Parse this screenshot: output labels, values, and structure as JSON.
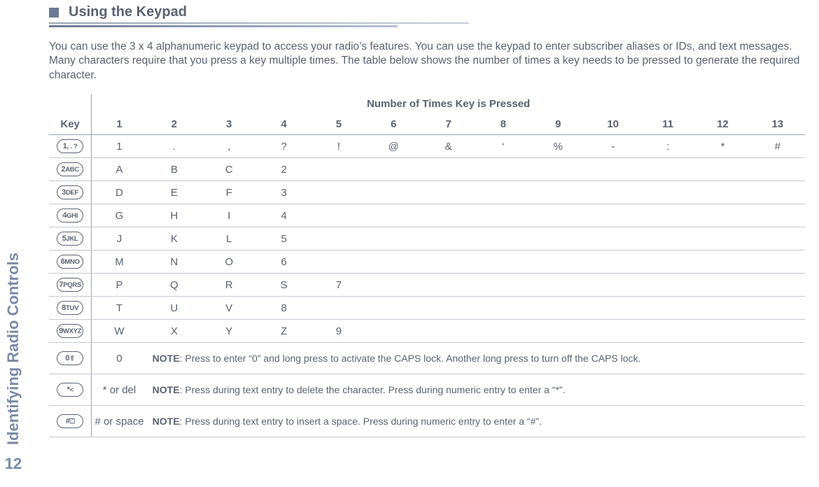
{
  "sidebar": {
    "label": "Identifying Radio Controls",
    "page": "12"
  },
  "section": {
    "title": "Using the Keypad",
    "intro": "You can use the 3 x 4 alphanumeric keypad to access your radio’s features. You can use the keypad to enter subscriber aliases or IDs, and text messages. Many characters require that you press a key multiple times. The table below shows the number of times a key needs to be pressed to generate the required character."
  },
  "table": {
    "span_label": "Number of Times Key is Pressed",
    "key_label": "Key",
    "cols": [
      "1",
      "2",
      "3",
      "4",
      "5",
      "6",
      "7",
      "8",
      "9",
      "10",
      "11",
      "12",
      "13"
    ],
    "rows": [
      {
        "key_main": "1",
        "key_sub": " , . ?",
        "vals": [
          "1",
          ".",
          ",",
          "?",
          "!",
          "@",
          "&",
          "‘",
          "%",
          "-",
          ":",
          "*",
          "#"
        ]
      },
      {
        "key_main": "2",
        "key_sub": " ABC",
        "vals": [
          "A",
          "B",
          "C",
          "2",
          "",
          "",
          "",
          "",
          "",
          "",
          "",
          "",
          ""
        ]
      },
      {
        "key_main": "3",
        "key_sub": " DEF",
        "vals": [
          "D",
          "E",
          "F",
          "3",
          "",
          "",
          "",
          "",
          "",
          "",
          "",
          "",
          ""
        ]
      },
      {
        "key_main": "4",
        "key_sub": " GHI",
        "vals": [
          "G",
          "H",
          "I",
          "4",
          "",
          "",
          "",
          "",
          "",
          "",
          "",
          "",
          ""
        ]
      },
      {
        "key_main": "5",
        "key_sub": " JKL",
        "vals": [
          "J",
          "K",
          "L",
          "5",
          "",
          "",
          "",
          "",
          "",
          "",
          "",
          "",
          ""
        ]
      },
      {
        "key_main": "6",
        "key_sub": " MNO",
        "vals": [
          "M",
          "N",
          "O",
          "6",
          "",
          "",
          "",
          "",
          "",
          "",
          "",
          "",
          ""
        ]
      },
      {
        "key_main": "7",
        "key_sub": "PQRS",
        "vals": [
          "P",
          "Q",
          "R",
          "S",
          "7",
          "",
          "",
          "",
          "",
          "",
          "",
          "",
          ""
        ]
      },
      {
        "key_main": "8",
        "key_sub": " TUV",
        "vals": [
          "T",
          "U",
          "V",
          "8",
          "",
          "",
          "",
          "",
          "",
          "",
          "",
          "",
          ""
        ]
      },
      {
        "key_main": "9",
        "key_sub": "WXYZ",
        "vals": [
          "W",
          "X",
          "Y",
          "Z",
          "9",
          "",
          "",
          "",
          "",
          "",
          "",
          "",
          ""
        ]
      }
    ],
    "note_rows": [
      {
        "key_main": "0",
        "key_sub": " ⇧",
        "c1": "0",
        "note_label": "NOTE",
        "note": ": Press to enter “0” and long press to activate the CAPS lock. Another long press to turn off the CAPS lock."
      },
      {
        "key_main": "*",
        "key_sub": " <",
        "c1": "* or del",
        "note_label": "NOTE",
        "note": ": Press during text entry to delete the character. Press during numeric entry to enter a “*”."
      },
      {
        "key_main": "#",
        "key_sub": " ⏍",
        "c1": "# or space",
        "note_label": "NOTE",
        "note": ": Press during text entry to insert a space. Press during numeric entry to enter a “#”."
      }
    ]
  }
}
